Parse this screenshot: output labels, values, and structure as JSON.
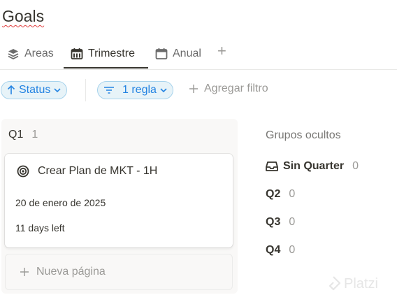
{
  "page": {
    "title": "Goals"
  },
  "tabs": [
    {
      "label": "Areas",
      "icon": "layers-icon"
    },
    {
      "label": "Trimestre",
      "icon": "calendar-month-icon",
      "active": true
    },
    {
      "label": "Anual",
      "icon": "calendar-icon"
    }
  ],
  "tab_add": "+",
  "filters": {
    "sort_label": "Status",
    "rule_label": "1 regla",
    "add_filter_label": "Agregar filtro"
  },
  "board": {
    "group_label": "Q1",
    "group_count": "1",
    "card": {
      "icon": "target-icon",
      "title": "Crear Plan de MKT - 1H",
      "date": "20 de enero de 2025",
      "days_left": "11 days left"
    },
    "new_page_label": "Nueva página"
  },
  "hidden_groups": {
    "header": "Grupos ocultos",
    "items": [
      {
        "label": "Sin Quarter",
        "count": "0",
        "icon": "inbox-icon"
      },
      {
        "label": "Q2",
        "count": "0"
      },
      {
        "label": "Q3",
        "count": "0"
      },
      {
        "label": "Q4",
        "count": "0"
      }
    ]
  },
  "watermark": "Platzi",
  "colors": {
    "accent": "#2383e2",
    "chip_bg": "#e7f3f8",
    "text": "#37352f",
    "muted": "#9b9a97"
  }
}
